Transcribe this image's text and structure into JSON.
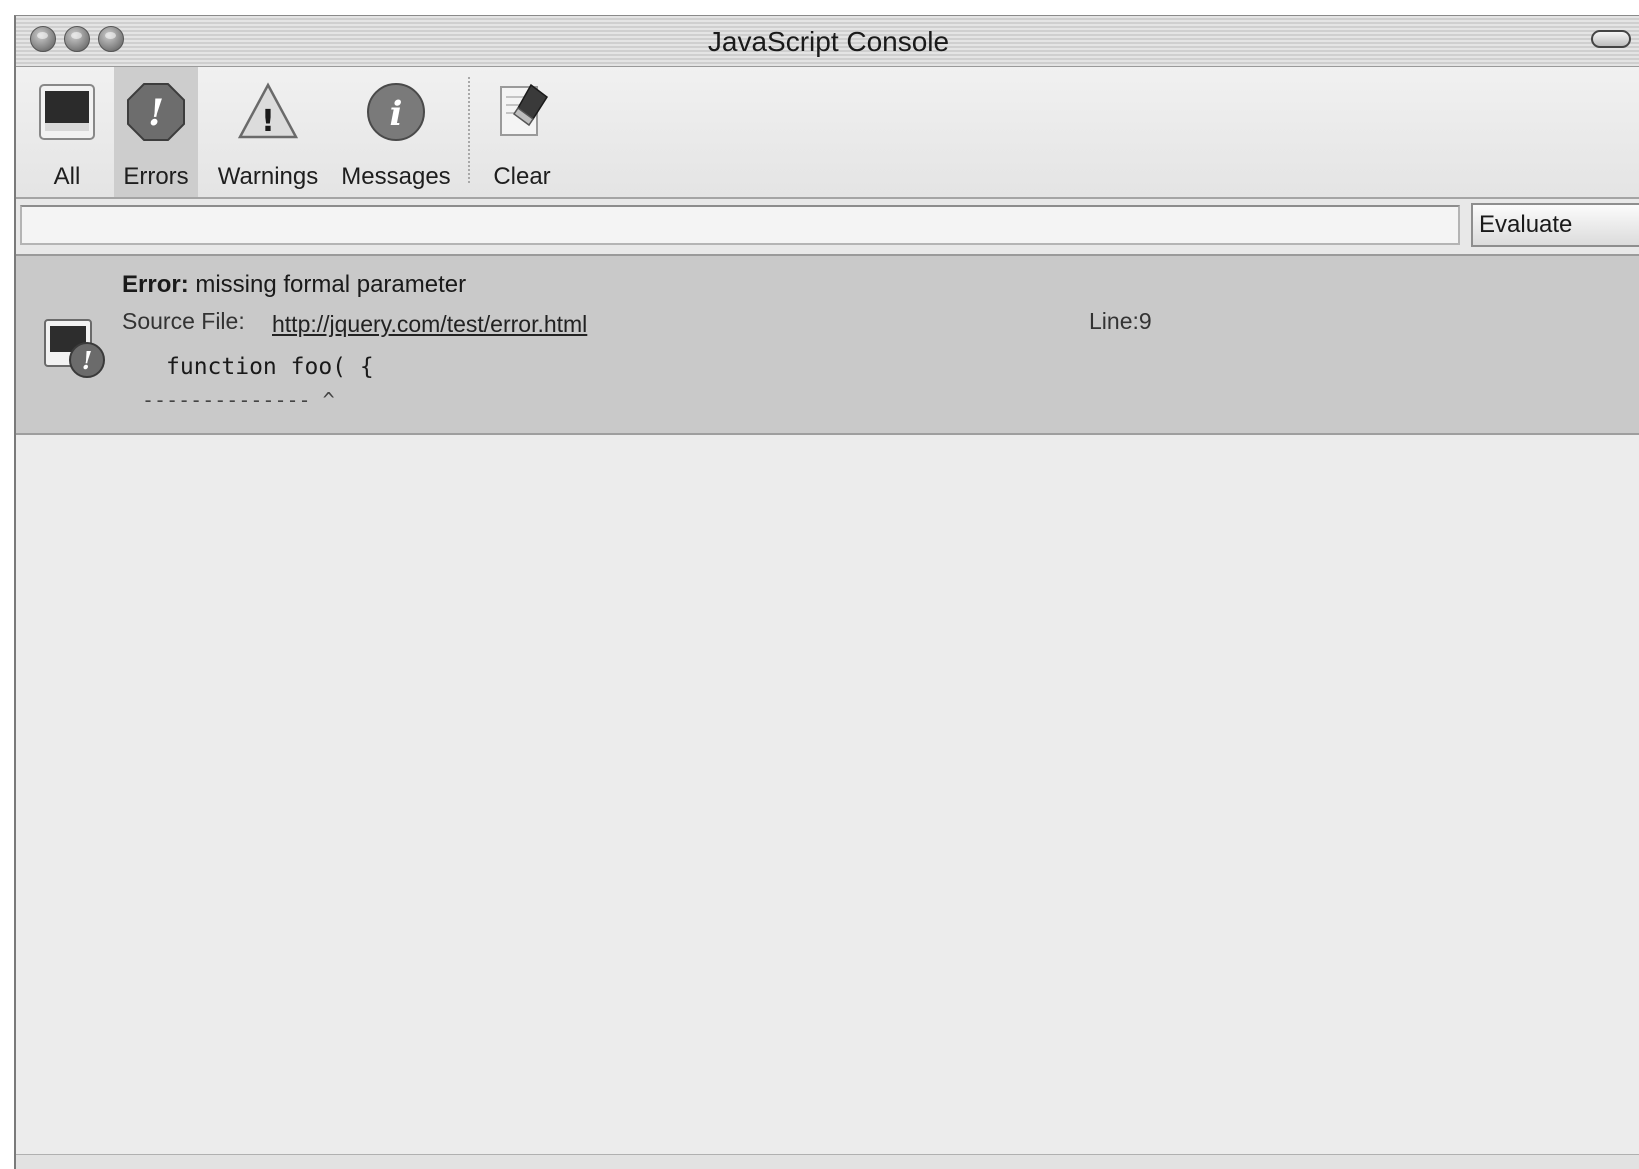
{
  "window": {
    "title": "JavaScript Console"
  },
  "toolbar": {
    "buttons": [
      {
        "id": "all",
        "label": "All",
        "icon": "all-console-icon",
        "selected": false
      },
      {
        "id": "errors",
        "label": "Errors",
        "icon": "error-icon",
        "selected": true
      },
      {
        "id": "warnings",
        "label": "Warnings",
        "icon": "warning-triangle-icon",
        "selected": false
      },
      {
        "id": "messages",
        "label": "Messages",
        "icon": "info-icon",
        "selected": false
      }
    ],
    "clear_label": "Clear"
  },
  "evaluate": {
    "input_value": "",
    "button_label": "Evaluate"
  },
  "entries": [
    {
      "prefix": "Error:",
      "message": "missing formal parameter",
      "source_label": "Source File:",
      "source_url": "http://jquery.com/test/error.html",
      "line_label": "Line:9",
      "code": "function foo( {",
      "pointer": "-------------- ^"
    }
  ],
  "colors": {
    "selected_tab_bg": "#cdcdcd",
    "entry_bg": "#c9c9c9"
  }
}
